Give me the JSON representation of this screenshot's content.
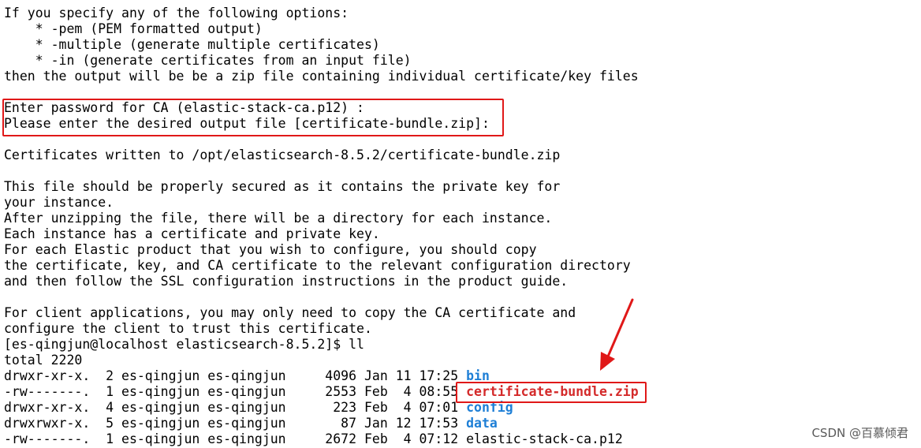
{
  "terminal": {
    "lines": [
      "If you specify any of the following options:",
      "    * -pem (PEM formatted output)",
      "    * -multiple (generate multiple certificates)",
      "    * -in (generate certificates from an input file)",
      "then the output will be be a zip file containing individual certificate/key files",
      "",
      "Enter password for CA (elastic-stack-ca.p12) :",
      "Please enter the desired output file [certificate-bundle.zip]:",
      "",
      "Certificates written to /opt/elasticsearch-8.5.2/certificate-bundle.zip",
      "",
      "This file should be properly secured as it contains the private key for",
      "your instance.",
      "After unzipping the file, there will be a directory for each instance.",
      "Each instance has a certificate and private key.",
      "For each Elastic product that you wish to configure, you should copy",
      "the certificate, key, and CA certificate to the relevant configuration directory",
      "and then follow the SSL configuration instructions in the product guide.",
      "",
      "For client applications, you may only need to copy the CA certificate and",
      "configure the client to trust this certificate.",
      "[es-qingjun@localhost elasticsearch-8.5.2]$ ll",
      "total 2220"
    ],
    "listing": [
      {
        "perm": "drwxr-xr-x.",
        "links": "2",
        "owner": "es-qingjun",
        "group": "es-qingjun",
        "size": "4096",
        "month": "Jan",
        "day": "11",
        "time": "17:25",
        "name": "bin",
        "kind": "dir"
      },
      {
        "perm": "-rw-------.",
        "links": "1",
        "owner": "es-qingjun",
        "group": "es-qingjun",
        "size": "2553",
        "month": "Feb",
        "day": "4",
        "time": "08:55",
        "name": "certificate-bundle.zip",
        "kind": "zip"
      },
      {
        "perm": "drwxr-xr-x.",
        "links": "4",
        "owner": "es-qingjun",
        "group": "es-qingjun",
        "size": "223",
        "month": "Feb",
        "day": "4",
        "time": "07:01",
        "name": "config",
        "kind": "dir"
      },
      {
        "perm": "drwxrwxr-x.",
        "links": "5",
        "owner": "es-qingjun",
        "group": "es-qingjun",
        "size": "87",
        "month": "Jan",
        "day": "12",
        "time": "17:53",
        "name": "data",
        "kind": "dir"
      },
      {
        "perm": "-rw-------.",
        "links": "1",
        "owner": "es-qingjun",
        "group": "es-qingjun",
        "size": "2672",
        "month": "Feb",
        "day": "4",
        "time": "07:12",
        "name": "elastic-stack-ca.p12",
        "kind": "plain"
      }
    ]
  },
  "colors": {
    "background": "#ffffff",
    "text": "#000000",
    "directory": "#1e7fd6",
    "archive": "#d42a2a",
    "annotation": "#e01818"
  },
  "watermark": "CSDN @百慕倾君"
}
